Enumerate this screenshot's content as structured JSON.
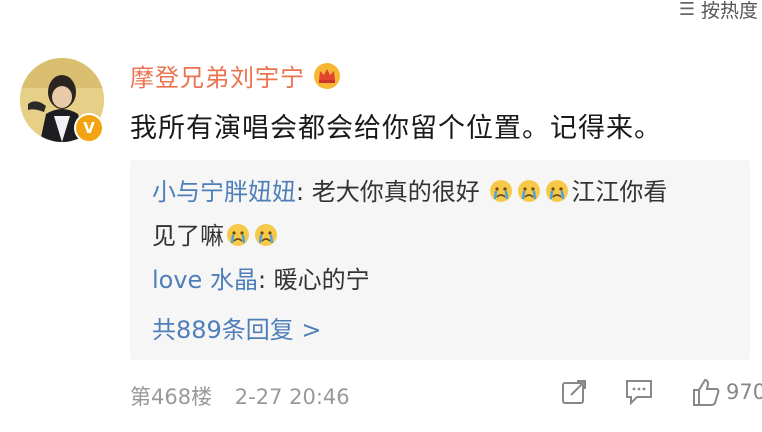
{
  "sort_label": "按热度",
  "sort_icon": "sort-icon",
  "comment": {
    "username": "摩登兄弟刘宇宁",
    "content": "我所有演唱会都会给你留个位置。记得来。",
    "floor": "第468楼",
    "time": "2-27 20:46",
    "like_count": "970",
    "accent_color": "#eb7350",
    "link_color": "#4e7fb8"
  },
  "replies": [
    {
      "name": "小与宁胖妞妞",
      "sep": ": ",
      "text_a": "老大你真的很好",
      "text_b": "江江你看",
      "text_c": "见了嘛"
    },
    {
      "name": "love 水晶",
      "sep": ": ",
      "text_a": "暖心的宁"
    }
  ],
  "more_replies": "共889条回复 >"
}
